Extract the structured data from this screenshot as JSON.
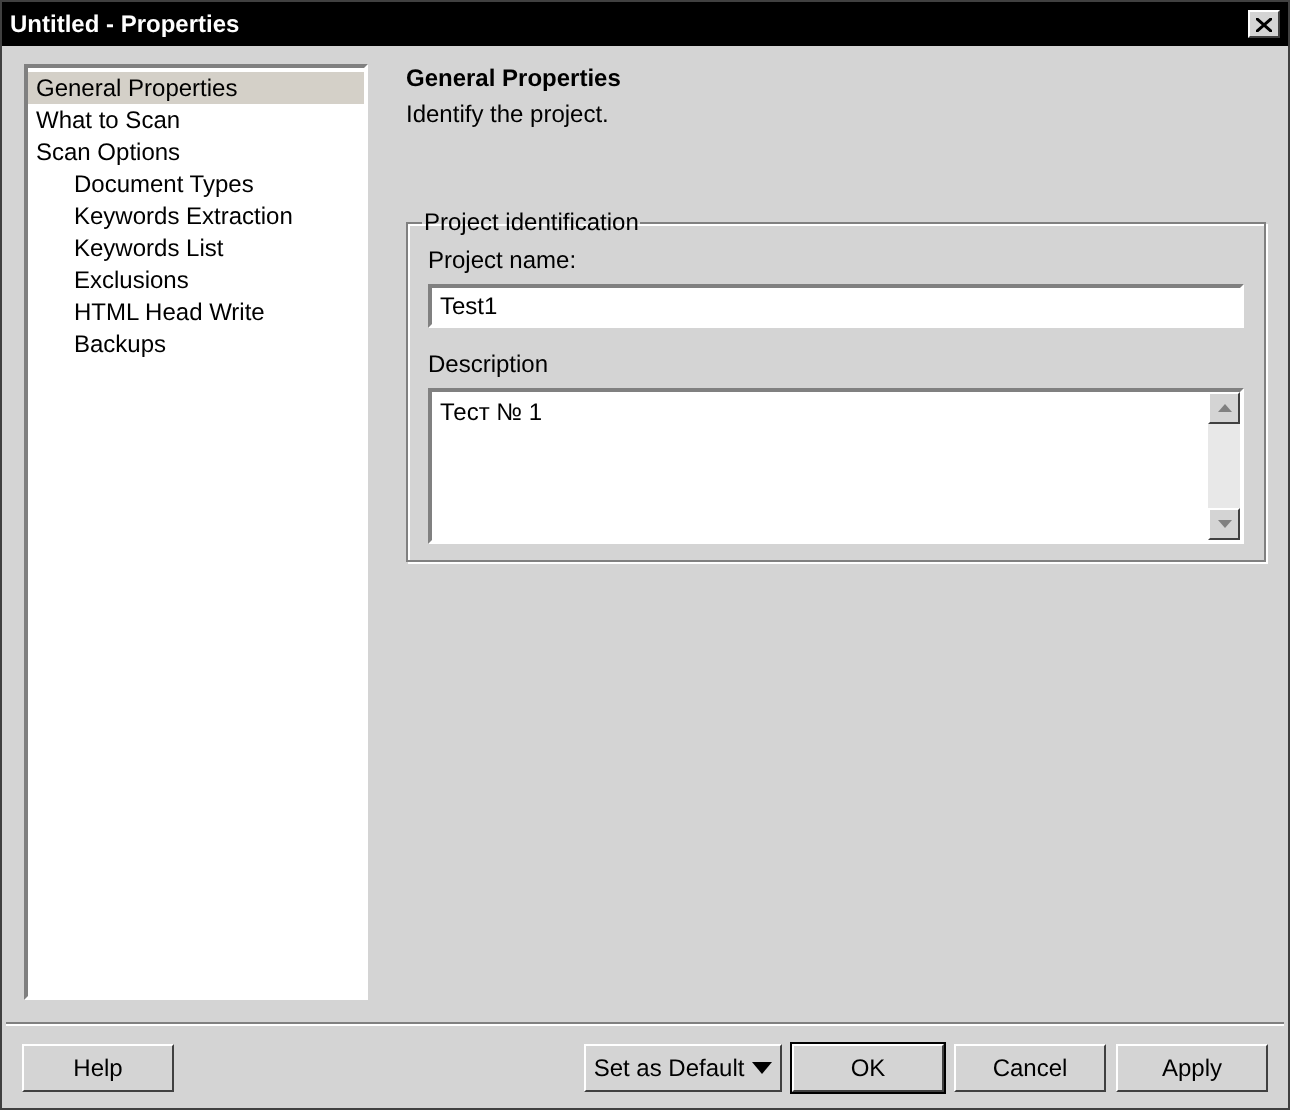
{
  "window": {
    "title": "Untitled - Properties"
  },
  "sidebar": {
    "items": [
      {
        "label": "General Properties",
        "selected": true
      },
      {
        "label": "What to Scan",
        "selected": false
      },
      {
        "label": "Scan Options",
        "selected": false,
        "children": [
          {
            "label": "Document Types",
            "selected": false
          },
          {
            "label": "Keywords Extraction",
            "selected": false
          },
          {
            "label": "Keywords List",
            "selected": false
          },
          {
            "label": "Exclusions",
            "selected": false
          },
          {
            "label": "HTML Head Write",
            "selected": false
          },
          {
            "label": "Backups",
            "selected": false
          }
        ]
      }
    ]
  },
  "page": {
    "title": "General Properties",
    "subtitle": "Identify the project.",
    "group": {
      "title": "Project identification",
      "name_label": "Project name:",
      "name_value": "Test1",
      "description_label": "Description",
      "description_value": "Тест № 1"
    }
  },
  "buttons": [
    {
      "label": "Help",
      "kind": "plain"
    },
    {
      "label": "Set as Default",
      "kind": "dropdown"
    },
    {
      "label": "OK",
      "kind": "default"
    },
    {
      "label": "Cancel",
      "kind": "plain"
    },
    {
      "label": "Apply",
      "kind": "plain"
    }
  ]
}
